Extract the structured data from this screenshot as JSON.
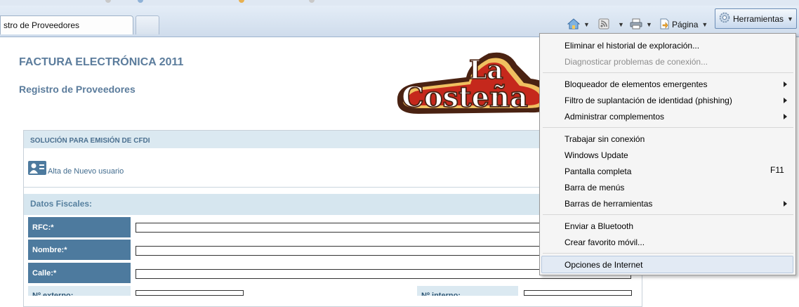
{
  "browser": {
    "active_tab_title": "stro de Proveedores",
    "toolbar": {
      "page_label": "Página",
      "tools_label": "Herramientas"
    }
  },
  "page": {
    "title": "FACTURA ELECTRÓNICA 2011",
    "subtitle": "Registro de Proveedores",
    "logo": {
      "line1": "La",
      "line2": "Costeña"
    },
    "panel": {
      "header": "SOLUCIÓN PARA EMISIÓN DE CFDI",
      "new_user_link": "Alta de Nuevo usuario",
      "section_title": "Datos Fiscales:",
      "fields": [
        {
          "label": "RFC:*",
          "value": ""
        },
        {
          "label": "Nombre:*",
          "value": ""
        },
        {
          "label": "Calle:*",
          "value": ""
        }
      ],
      "partial_fields": [
        {
          "label": "Nº externo:",
          "value": ""
        },
        {
          "label": "Nº interno:",
          "value": ""
        }
      ]
    }
  },
  "tools_menu": {
    "items": [
      {
        "label": "Eliminar el historial de exploración...",
        "enabled": true
      },
      {
        "label": "Diagnosticar problemas de conexión...",
        "enabled": false
      },
      {
        "label": "Bloqueador de elementos emergentes",
        "submenu": true
      },
      {
        "label": "Filtro de suplantación de identidad (phishing)",
        "submenu": true
      },
      {
        "label": "Administrar complementos",
        "submenu": true
      },
      {
        "label": "Trabajar sin conexión"
      },
      {
        "label": "Windows Update"
      },
      {
        "label": "Pantalla completa",
        "shortcut": "F11"
      },
      {
        "label": "Barra de menús"
      },
      {
        "label": "Barras de herramientas",
        "submenu": true
      },
      {
        "label": "Enviar a Bluetooth"
      },
      {
        "label": "Crear favorito móvil..."
      },
      {
        "label": "Opciones de Internet",
        "highlighted": true
      }
    ]
  },
  "colors": {
    "label_bg": "#4d7a9e",
    "section_bg": "#d6e6ef",
    "heading_text": "#5b7c9c",
    "logo_red": "#c5281c",
    "logo_brown": "#4a2212",
    "menu_highlight": "#e2eaf4"
  },
  "icons": [
    "home-icon",
    "rss-feed-icon",
    "print-icon",
    "page-icon",
    "gear-icon",
    "user-icon"
  ]
}
